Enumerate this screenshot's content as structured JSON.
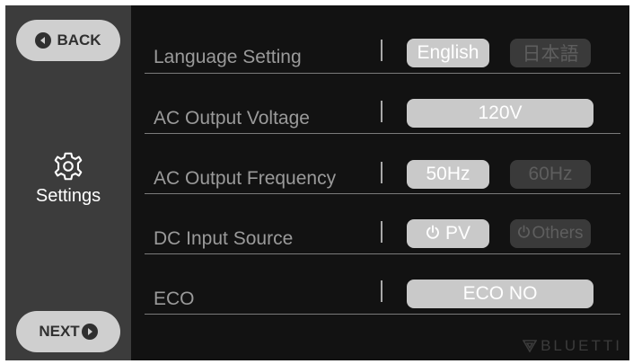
{
  "nav": {
    "back_label": "BACK",
    "next_label": "NEXT"
  },
  "sidebar": {
    "settings_label": "Settings"
  },
  "rows": {
    "language": {
      "label": "Language Setting",
      "options": [
        "English",
        "日本語"
      ]
    },
    "voltage": {
      "label": "AC Output Voltage",
      "value": "120V"
    },
    "frequency": {
      "label": "AC Output Frequency",
      "options": [
        "50Hz",
        "60Hz"
      ]
    },
    "dc_input": {
      "label": "DC Input Source",
      "options": [
        "PV",
        "Others"
      ]
    },
    "eco": {
      "label": "ECO",
      "value": "ECO NO"
    }
  },
  "brand": {
    "name": "BLUETTI"
  },
  "colors": {
    "screen_bg": "#121212",
    "sidebar_bg": "#3c3c3c",
    "active_pill": "#c9c9c9",
    "inactive_pill": "#3a3a3a"
  },
  "icons": [
    "back-arrow-icon",
    "next-arrow-icon",
    "gear-icon",
    "power-icon",
    "bluetti-logo-icon"
  ]
}
